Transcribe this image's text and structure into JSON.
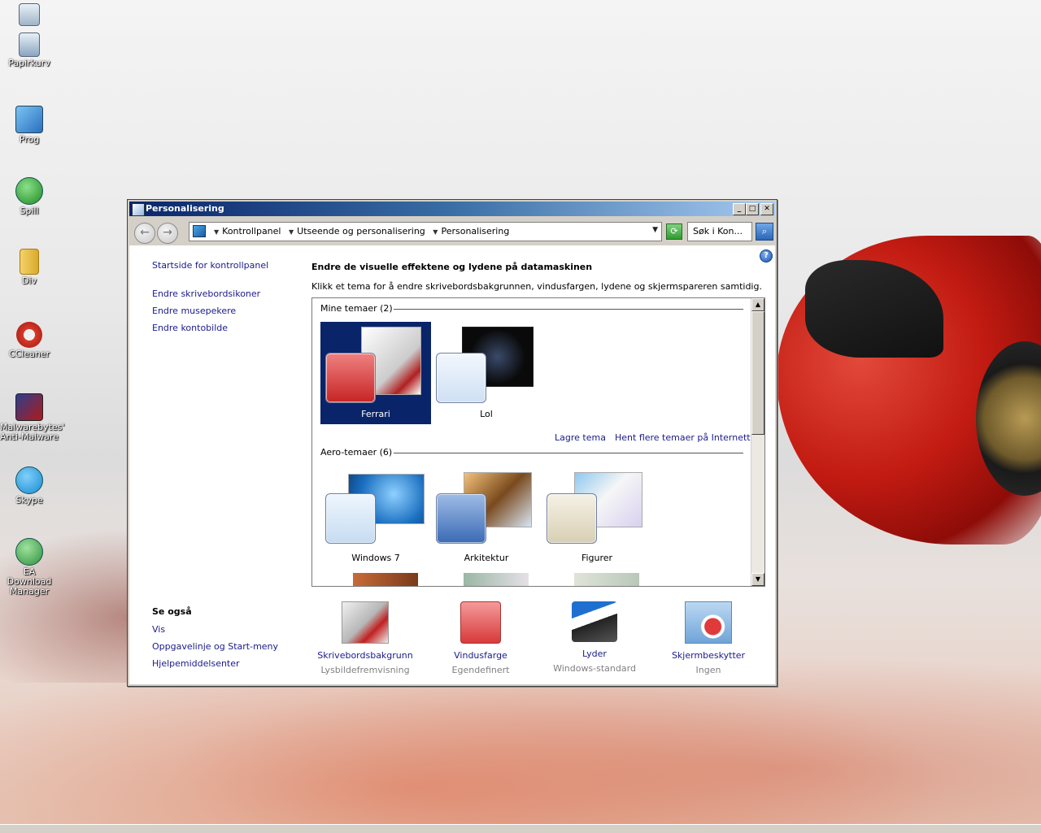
{
  "desktop": {
    "icons": [
      {
        "label": ""
      },
      {
        "label": "Papirkurv"
      },
      {
        "label": "Prog"
      },
      {
        "label": "Spill"
      },
      {
        "label": "Div"
      },
      {
        "label": "CCleaner"
      },
      {
        "label": "Malwarebytes' Anti-Malware"
      },
      {
        "label": "Skype"
      },
      {
        "label": "EA Download Manager"
      }
    ]
  },
  "window": {
    "title": "Personalisering",
    "address": {
      "crumbs": [
        "Kontrollpanel",
        "Utseende og personalisering",
        "Personalisering"
      ],
      "search_placeholder": "Søk i Kon..."
    },
    "left_pane": {
      "links": [
        "Startside for kontrollpanel",
        "Endre skrivebordsikoner",
        "Endre musepekere",
        "Endre kontobilde"
      ],
      "see_also_title": "Se også",
      "see_also": [
        "Vis",
        "Oppgavelinje og Start-meny",
        "Hjelpemiddelsenter"
      ]
    },
    "main": {
      "heading": "Endre de visuelle effektene og lydene på datamaskinen",
      "subtext": "Klikk et tema for å endre skrivebordsbakgrunnen, vindusfargen, lydene og skjermspareren samtidig.",
      "my_themes_title": "Mine temaer (2)",
      "my_themes": [
        {
          "name": "Ferrari",
          "selected": true
        },
        {
          "name": "Lol",
          "selected": false
        }
      ],
      "save_theme": "Lagre tema",
      "get_more": "Hent flere temaer på Internett",
      "aero_title": "Aero-temaer (6)",
      "aero_themes": [
        {
          "name": "Windows 7"
        },
        {
          "name": "Arkitektur"
        },
        {
          "name": "Figurer"
        }
      ]
    },
    "bottom": [
      {
        "title": "Skrivebordsbakgrunn",
        "value": "Lysbildefremvisning",
        "icon": "desktop-background-icon"
      },
      {
        "title": "Vindusfarge",
        "value": "Egendefinert",
        "icon": "window-color-icon"
      },
      {
        "title": "Lyder",
        "value": "Windows-standard",
        "icon": "sounds-icon"
      },
      {
        "title": "Skjermbeskytter",
        "value": "Ingen",
        "icon": "screensaver-icon"
      }
    ]
  },
  "colors": {
    "selection": "#0a246a",
    "link": "#1a1a8c",
    "window_color_swatch": "#d83a3a"
  }
}
